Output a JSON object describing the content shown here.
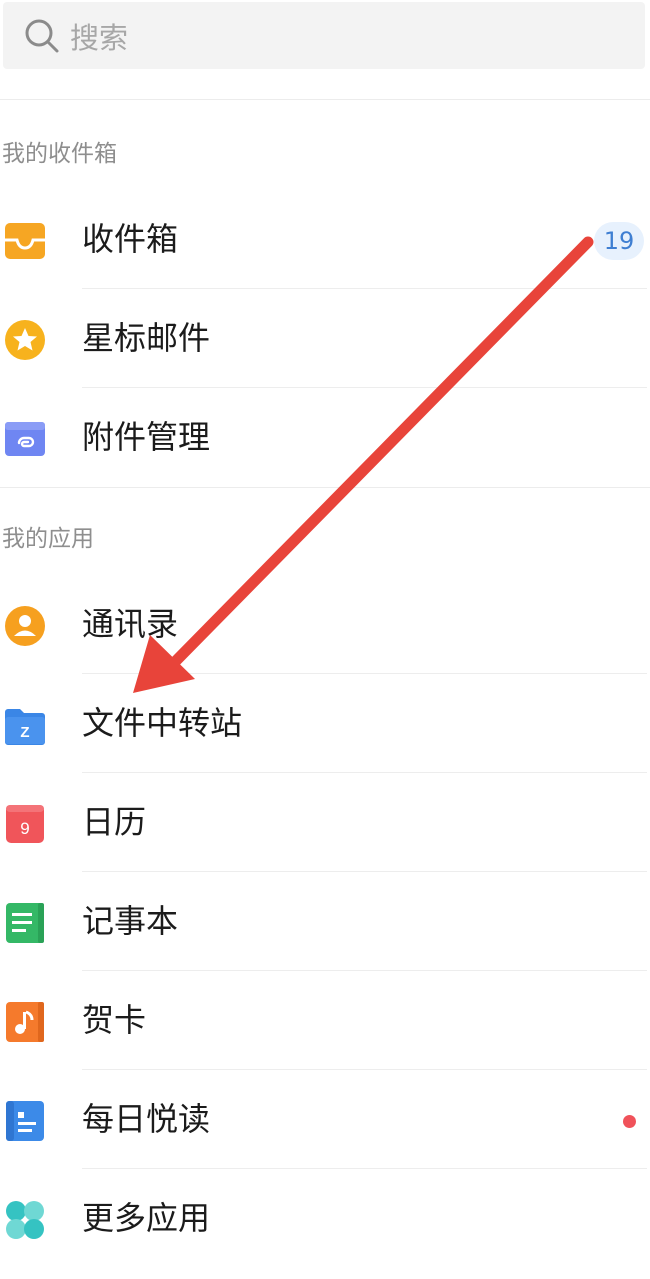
{
  "search": {
    "placeholder": "搜索"
  },
  "sections": {
    "mailbox_title": "我的收件箱",
    "apps_title": "我的应用"
  },
  "mailbox_items": [
    {
      "label": "收件箱",
      "icon": "inbox-tray-icon",
      "badge": "19"
    },
    {
      "label": "星标邮件",
      "icon": "star-icon"
    },
    {
      "label": "附件管理",
      "icon": "paperclip-folder-icon"
    }
  ],
  "app_items": [
    {
      "label": "通讯录",
      "icon": "contacts-person-icon"
    },
    {
      "label": "文件中转站",
      "icon": "file-transfer-folder-icon"
    },
    {
      "label": "日历",
      "icon": "calendar-icon",
      "icon_text": "9"
    },
    {
      "label": "记事本",
      "icon": "notepad-icon"
    },
    {
      "label": "贺卡",
      "icon": "greeting-card-music-icon"
    },
    {
      "label": "每日悦读",
      "icon": "daily-reading-icon",
      "has_red_dot": true
    },
    {
      "label": "更多应用",
      "icon": "more-apps-icon"
    }
  ],
  "folder_icon_letter": "Z",
  "colors": {
    "inbox": "#f6a623",
    "star": "#f7b21d",
    "attachment": "#6f86f2",
    "contacts": "#f6a01f",
    "file_transfer": "#3a86e6",
    "calendar": "#f0555a",
    "notepad": "#34b866",
    "greeting_card": "#f57a2c",
    "daily_reading": "#3c8ae8",
    "more_apps": "#35c3c2",
    "badge_text": "#3f7fd2",
    "annotation_arrow": "#e8443a"
  }
}
